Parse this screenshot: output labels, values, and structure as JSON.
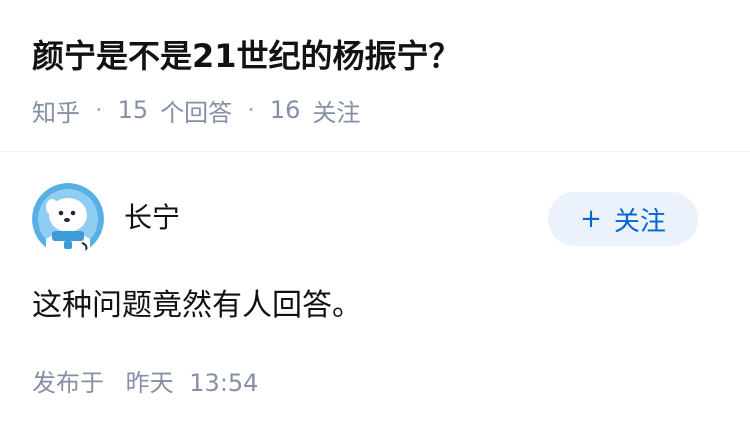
{
  "question": {
    "title": "颜宁是不是21世纪的杨振宁？",
    "source": "知乎",
    "answer_count": "15",
    "answer_label": "个回答",
    "follow_count": "16",
    "follow_label": "关注"
  },
  "author": {
    "name": "长宁",
    "follow_button_plus": "+",
    "follow_button_label": "关注",
    "avatar_icon": "penguin-avatar-icon"
  },
  "answer": {
    "content": "这种问题竟然有人回答。",
    "published_prefix": "发布于",
    "published_day": "昨天",
    "published_time": "13:54"
  },
  "colors": {
    "text_primary": "#121212",
    "text_meta": "#8590a6",
    "follow_bg": "#ebf2fb",
    "follow_text": "#0566cf",
    "avatar_bg": "#5aaee6"
  }
}
